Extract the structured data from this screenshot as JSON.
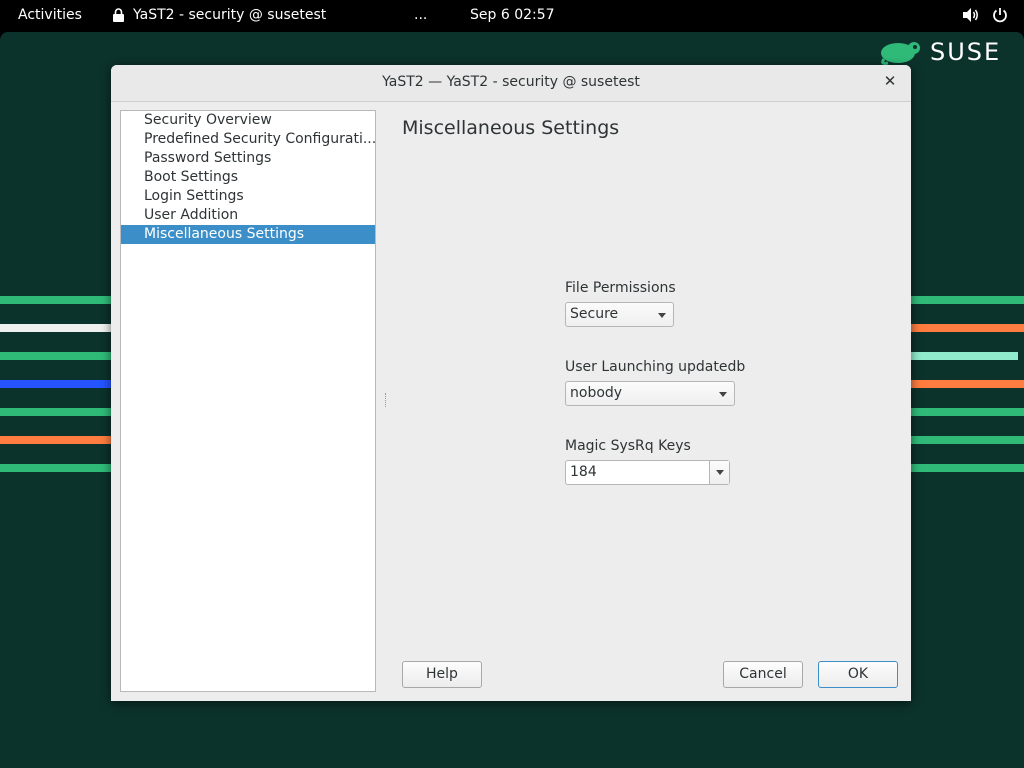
{
  "topbar": {
    "activities": "Activities",
    "app_title": "YaST2 - security @ susetest",
    "overflow": "...",
    "clock": "Sep 6  02:57"
  },
  "desktop": {
    "logo_text": "SUSE",
    "colors": {
      "background": "#0c322c",
      "green": "#30ba78",
      "orange": "#fe7c3f",
      "blue": "#2453ff",
      "mint": "#90ebcd",
      "white": "#efefef"
    }
  },
  "window": {
    "title": "YaST2 — YaST2 - security @ susetest",
    "nav_items": [
      "Security Overview",
      "Predefined Security Configurati...",
      "Password Settings",
      "Boot Settings",
      "Login Settings",
      "User Addition",
      "Miscellaneous Settings"
    ],
    "selected_nav": "Miscellaneous Settings",
    "heading": "Miscellaneous Settings",
    "file_permissions": {
      "label": "File Permissions",
      "value": "Secure"
    },
    "updatedb_user": {
      "label": "User Launching updatedb",
      "value": "nobody"
    },
    "sysrq": {
      "label": "Magic SysRq Keys",
      "value": "184"
    },
    "buttons": {
      "help": "Help",
      "cancel": "Cancel",
      "ok": "OK"
    },
    "accent_color": "#3b8ec7"
  }
}
